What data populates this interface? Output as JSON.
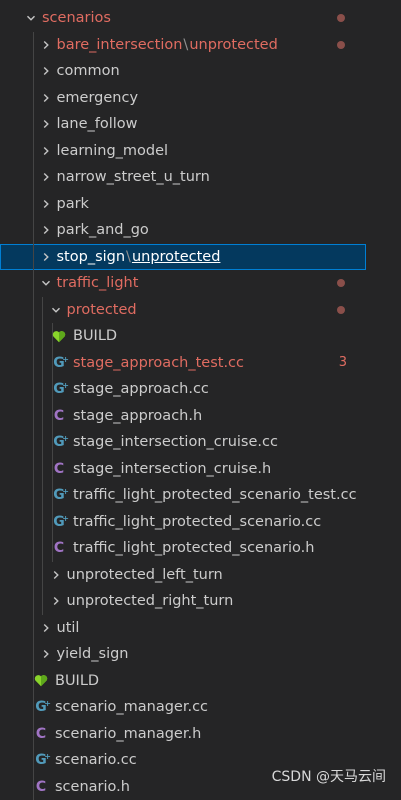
{
  "explorer": {
    "items": [
      {
        "label": "scenarios",
        "kind": "folder",
        "open": true,
        "depth": 0,
        "modified": true,
        "dot": true
      },
      {
        "label": "bare_intersection",
        "label_suffix": "unprotected",
        "kind": "folder",
        "open": false,
        "depth": 1,
        "modified": true,
        "dot": true
      },
      {
        "label": "common",
        "kind": "folder",
        "open": false,
        "depth": 1
      },
      {
        "label": "emergency",
        "kind": "folder",
        "open": false,
        "depth": 1
      },
      {
        "label": "lane_follow",
        "kind": "folder",
        "open": false,
        "depth": 1
      },
      {
        "label": "learning_model",
        "kind": "folder",
        "open": false,
        "depth": 1
      },
      {
        "label": "narrow_street_u_turn",
        "kind": "folder",
        "open": false,
        "depth": 1
      },
      {
        "label": "park",
        "kind": "folder",
        "open": false,
        "depth": 1
      },
      {
        "label": "park_and_go",
        "kind": "folder",
        "open": false,
        "depth": 1
      },
      {
        "label": "stop_sign",
        "label_suffix": "unprotected",
        "kind": "folder",
        "open": false,
        "depth": 1,
        "selected": true
      },
      {
        "label": "traffic_light",
        "kind": "folder",
        "open": true,
        "depth": 1,
        "modified": true,
        "dot": true
      },
      {
        "label": "protected",
        "kind": "folder",
        "open": true,
        "depth": 2,
        "modified": true,
        "dot": true
      },
      {
        "label": "BUILD",
        "kind": "bazel",
        "depth": 3
      },
      {
        "label": "stage_approach_test.cc",
        "kind": "cpp",
        "depth": 3,
        "modified": true,
        "count": "3"
      },
      {
        "label": "stage_approach.cc",
        "kind": "cpp",
        "depth": 3
      },
      {
        "label": "stage_approach.h",
        "kind": "c",
        "depth": 3
      },
      {
        "label": "stage_intersection_cruise.cc",
        "kind": "cpp",
        "depth": 3
      },
      {
        "label": "stage_intersection_cruise.h",
        "kind": "c",
        "depth": 3
      },
      {
        "label": "traffic_light_protected_scenario_test.cc",
        "kind": "cpp",
        "depth": 3
      },
      {
        "label": "traffic_light_protected_scenario.cc",
        "kind": "cpp",
        "depth": 3
      },
      {
        "label": "traffic_light_protected_scenario.h",
        "kind": "c",
        "depth": 3
      },
      {
        "label": "unprotected_left_turn",
        "kind": "folder",
        "open": false,
        "depth": 2
      },
      {
        "label": "unprotected_right_turn",
        "kind": "folder",
        "open": false,
        "depth": 2
      },
      {
        "label": "util",
        "kind": "folder",
        "open": false,
        "depth": 1
      },
      {
        "label": "yield_sign",
        "kind": "folder",
        "open": false,
        "depth": 1
      },
      {
        "label": "BUILD",
        "kind": "bazel",
        "depth": 1
      },
      {
        "label": "scenario_manager.cc",
        "kind": "cpp",
        "depth": 1
      },
      {
        "label": "scenario_manager.h",
        "kind": "c",
        "depth": 1
      },
      {
        "label": "scenario.cc",
        "kind": "cpp",
        "depth": 1
      },
      {
        "label": "scenario.h",
        "kind": "c",
        "depth": 1
      }
    ],
    "separator": "\\"
  },
  "watermark": "CSDN @天马云间",
  "colors": {
    "background": "#252526",
    "text": "#cccccc",
    "modified": "#e06c61",
    "selected_bg": "#04395e",
    "selected_border": "#007fd4",
    "cpp_icon": "#519aba",
    "c_icon": "#a074c4",
    "bazel_icon": "#89d42b"
  },
  "icons": {
    "folder_closed": "chevron-right-icon",
    "folder_open": "chevron-down-icon",
    "cpp": "cpp-file-icon",
    "c": "c-header-file-icon",
    "bazel": "bazel-heart-icon"
  }
}
